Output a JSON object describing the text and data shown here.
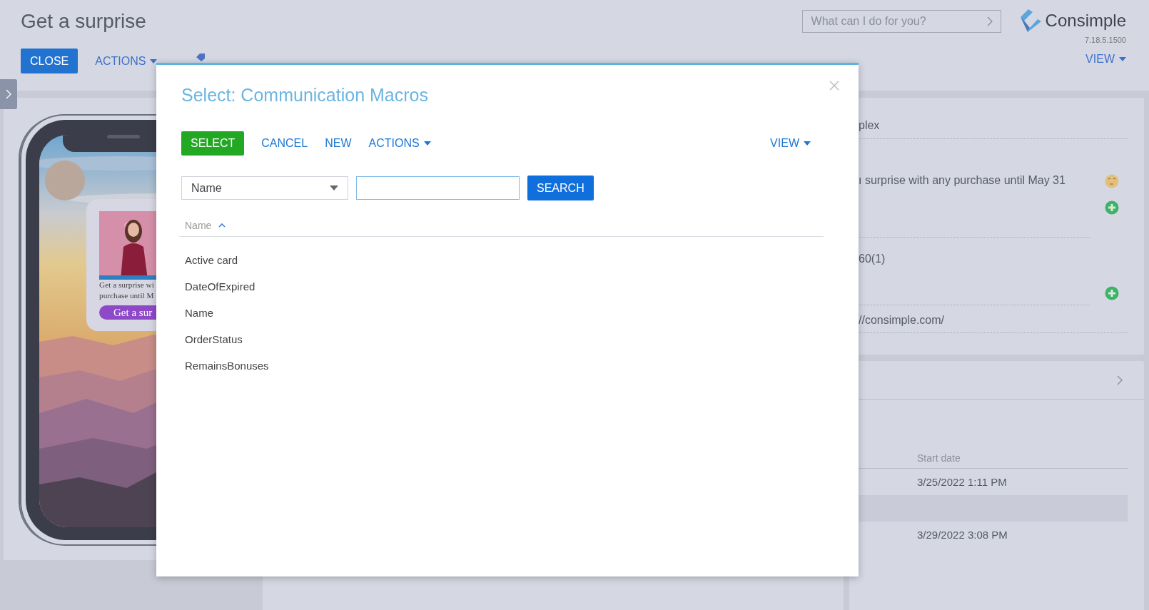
{
  "page": {
    "title": "Get a surprise",
    "toolbar": [
      {
        "label": "CLOSE",
        "kind": "primary"
      },
      {
        "label": "ACTIONS",
        "kind": "menu"
      }
    ],
    "search": {
      "placeholder": "What can I do for you?"
    },
    "logo": {
      "name": "Consimple",
      "version": "7.18.5.1500"
    },
    "view": "VIEW"
  },
  "preview": {
    "lines": [
      "Get a surprise wi",
      "purchase until M"
    ],
    "button": "Get a sur"
  },
  "details": {
    "fields": [
      {
        "value": "plex"
      },
      {
        "value": "ı surprise with any purchase until May 31",
        "icons": [
          {
            "kind": "emoji"
          },
          {
            "kind": "add"
          }
        ]
      },
      {
        "value": "60(1)",
        "icons": [
          {
            "kind": "add"
          }
        ]
      },
      {
        "value": "//consimple.com/"
      }
    ]
  },
  "history": {
    "column": "Start date",
    "rows": [
      {
        "start_date": "3/25/2022 1:11 PM",
        "highlighted": false
      },
      {
        "highlighted": true
      },
      {
        "start_date": "3/29/2022 3:08 PM",
        "highlighted": false
      }
    ]
  },
  "dialog": {
    "title": "Select: Communication Macros",
    "buttons": [
      {
        "label": "SELECT",
        "kind": "primary"
      },
      {
        "label": "CANCEL",
        "kind": "link"
      },
      {
        "label": "NEW",
        "kind": "link"
      },
      {
        "label": "ACTIONS",
        "kind": "menu"
      }
    ],
    "view": "VIEW",
    "filter": {
      "column": "Name",
      "focused": true,
      "button": "SEARCH"
    },
    "list": {
      "column": "Name",
      "sort_ascending": true,
      "rows": [
        "Active card",
        "DateOfExpired",
        "Name",
        "OrderStatus",
        "RemainsBonuses"
      ]
    }
  }
}
